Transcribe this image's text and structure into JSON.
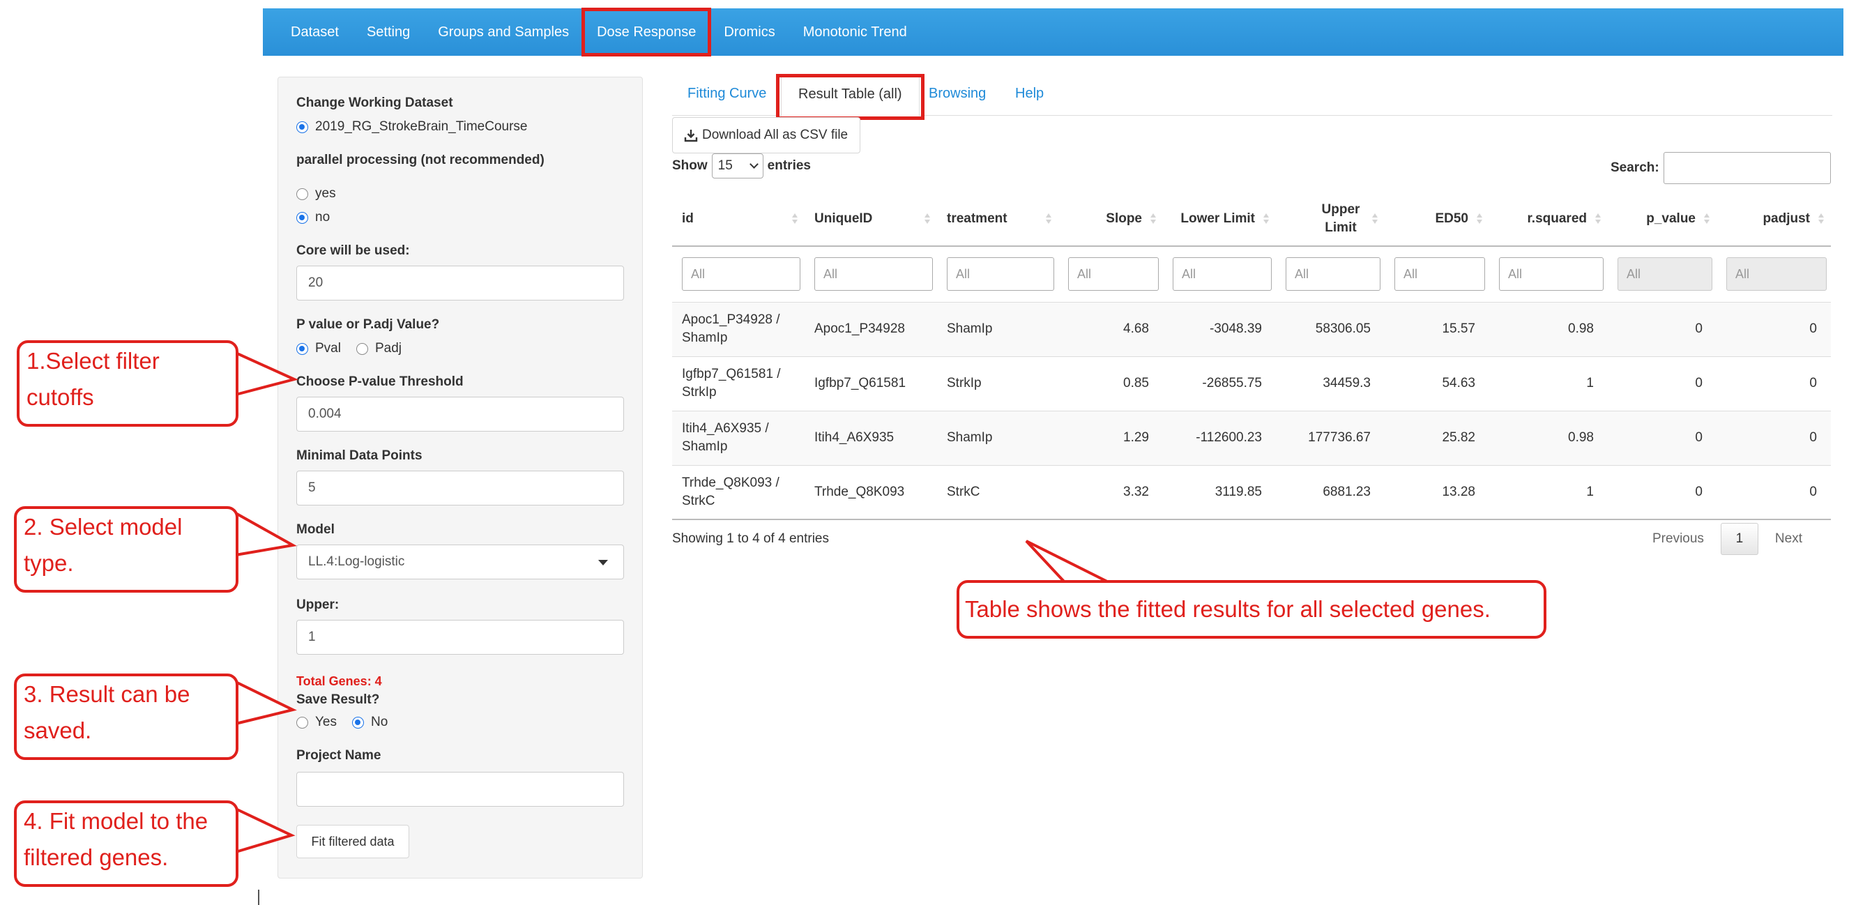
{
  "nav": {
    "items": [
      "Dataset",
      "Setting",
      "Groups and Samples",
      "Dose Response",
      "Dromics",
      "Monotonic Trend"
    ],
    "active_index": 3
  },
  "sidebar": {
    "dataset_label": "Change Working Dataset",
    "dataset_option": "2019_RG_StrokeBrain_TimeCourse",
    "parallel_label": "parallel processing (not recommended)",
    "parallel_yes": "yes",
    "parallel_no": "no",
    "core_label": "Core will be used:",
    "core_value": "20",
    "pval_type_label": "P value or P.adj Value?",
    "pval_option": "Pval",
    "padj_option": "Padj",
    "threshold_label": "Choose P-value Threshold",
    "threshold_value": "0.004",
    "min_points_label": "Minimal Data Points",
    "min_points_value": "5",
    "model_label": "Model",
    "model_value": "LL.4:Log-logistic",
    "upper_label": "Upper:",
    "upper_value": "1",
    "total_genes": "Total Genes: 4",
    "save_label": "Save Result?",
    "save_yes": "Yes",
    "save_no": "No",
    "project_label": "Project Name",
    "project_value": "",
    "fit_button": "Fit filtered data"
  },
  "tabs": {
    "items": [
      "Fitting Curve",
      "Result Table (all)",
      "Browsing",
      "Help"
    ],
    "active_index": 1
  },
  "download_button": "Download All as CSV file",
  "table_controls": {
    "show": "Show",
    "entries_value": "15",
    "entries": "entries",
    "search_label": "Search:"
  },
  "table": {
    "headers": [
      "id",
      "UniqueID",
      "treatment",
      "Slope",
      "Lower Limit",
      "Upper Limit",
      "ED50",
      "r.squared",
      "p_value",
      "padjust"
    ],
    "filter_placeholder": "All",
    "rows": [
      [
        "Apoc1_P34928 / ShamIp",
        "Apoc1_P34928",
        "ShamIp",
        "4.68",
        "-3048.39",
        "58306.05",
        "15.57",
        "0.98",
        "0",
        "0"
      ],
      [
        "Igfbp7_Q61581 / StrkIp",
        "Igfbp7_Q61581",
        "StrkIp",
        "0.85",
        "-26855.75",
        "34459.3",
        "54.63",
        "1",
        "0",
        "0"
      ],
      [
        "Itih4_A6X935 / ShamIp",
        "Itih4_A6X935",
        "ShamIp",
        "1.29",
        "-112600.23",
        "177736.67",
        "25.82",
        "0.98",
        "0",
        "0"
      ],
      [
        "Trhde_Q8K093 / StrkC",
        "Trhde_Q8K093",
        "StrkC",
        "3.32",
        "3119.85",
        "6881.23",
        "13.28",
        "1",
        "0",
        "0"
      ]
    ],
    "info": "Showing 1 to 4 of 4 entries",
    "pager": {
      "previous": "Previous",
      "page": "1",
      "next": "Next"
    }
  },
  "annotations": {
    "step1": "1.Select filter cutoffs",
    "step2": "2. Select model type.",
    "step3": "3. Result can be saved.",
    "step4": "4. Fit model to the filtered genes.",
    "main": "Table shows the fitted results for all selected genes."
  },
  "colors": {
    "navbar": "#2a90d8",
    "highlight_red": "#e0201c",
    "link_blue": "#1e8ad8"
  }
}
